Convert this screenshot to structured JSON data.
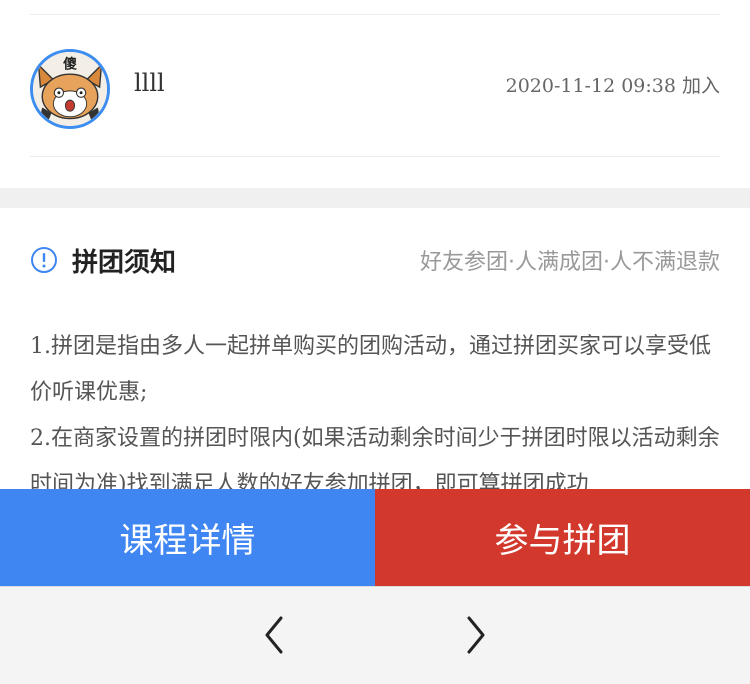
{
  "member": {
    "name": "llll",
    "join_time": "2020-11-12  09:38 加入",
    "avatar_text": "傻",
    "avatar_border_color": "#3d8df0"
  },
  "notice": {
    "icon": "info-circle-icon",
    "title": "拼团须知",
    "tags": "好友参团·人满成团·人不满退款",
    "rule_1": "1.拼团是指由多人一起拼单购买的团购活动，通过拼团买家可以享受低价听课优惠;",
    "rule_2": "2.在商家设置的拼团时限内(如果活动剩余时间少于拼团时限以活动剩余时间为准)找到满足人数的好友参加拼团，即可算拼团成功"
  },
  "actions": {
    "detail_label": "课程详情",
    "join_label": "参与拼团",
    "detail_color": "#3f86f3",
    "join_color": "#d2382b"
  },
  "browser": {
    "back_icon": "chevron-left-icon",
    "forward_icon": "chevron-right-icon"
  }
}
